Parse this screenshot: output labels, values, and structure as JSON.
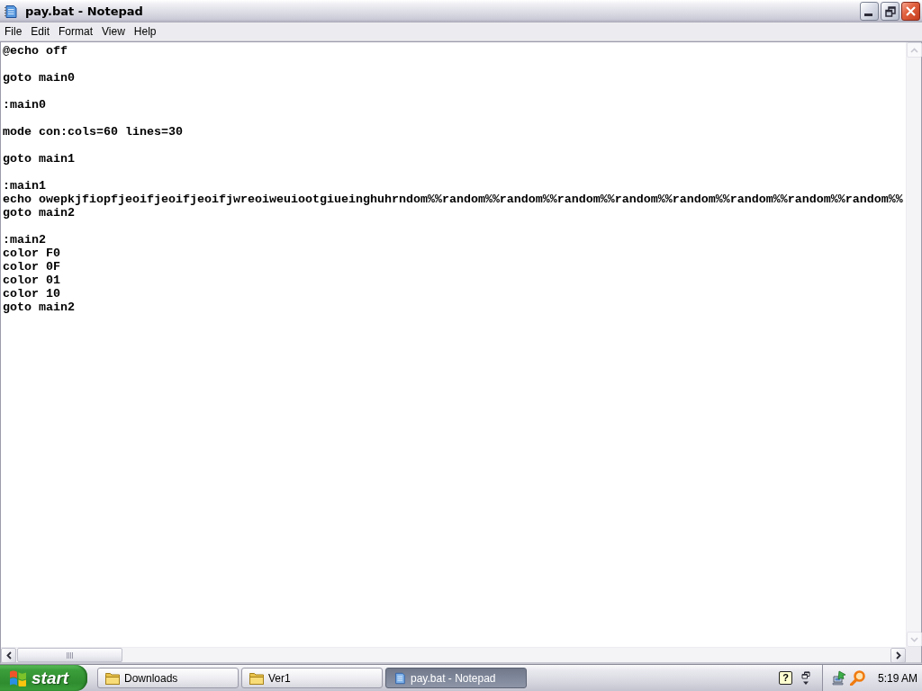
{
  "window": {
    "title": "pay.bat - Notepad"
  },
  "menu": [
    "File",
    "Edit",
    "Format",
    "View",
    "Help"
  ],
  "editor": {
    "content": "@echo off\n\ngoto main0\n\n:main0\n\nmode con:cols=60 lines=30\n\ngoto main1\n\n:main1\necho owepkjfiopfjeoifjeoifjeoifjwreoiweuiootgiueinghuhrndom%%random%%random%%random%%random%%random%%random%%random%%random%%\ngoto main2\n\n:main2\ncolor F0\ncolor 0F\ncolor 01\ncolor 10\ngoto main2"
  },
  "taskbar": {
    "start_label": "start",
    "tasks": [
      {
        "label": "Downloads",
        "kind": "folder",
        "selected": false
      },
      {
        "label": "Ver1",
        "kind": "folder",
        "selected": false
      },
      {
        "label": "pay.bat - Notepad",
        "kind": "notepad",
        "selected": true
      }
    ],
    "help_icon": "?",
    "clock": "5:19 AM"
  }
}
